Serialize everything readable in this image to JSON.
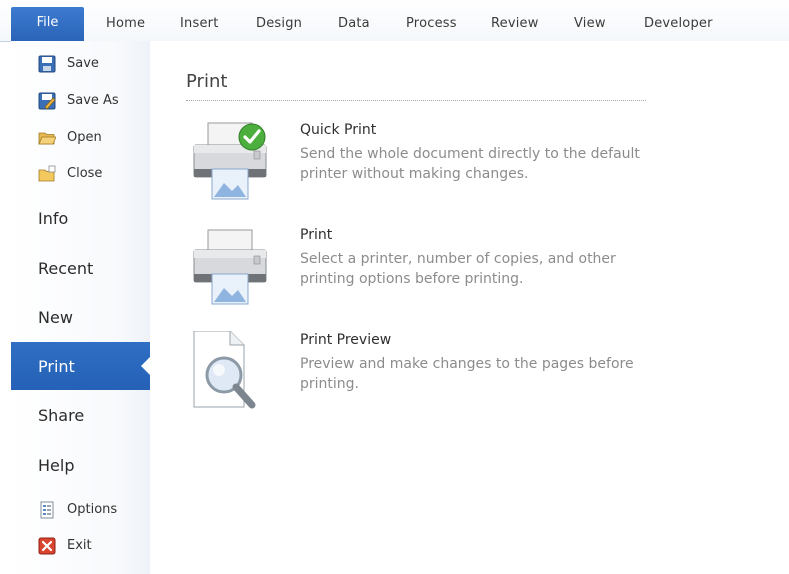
{
  "ribbon": {
    "tabs": [
      {
        "label": "File"
      },
      {
        "label": "Home"
      },
      {
        "label": "Insert"
      },
      {
        "label": "Design"
      },
      {
        "label": "Data"
      },
      {
        "label": "Process"
      },
      {
        "label": "Review"
      },
      {
        "label": "View"
      },
      {
        "label": "Developer"
      }
    ],
    "active_tab": "File"
  },
  "sidebar": {
    "commands": [
      {
        "label": "Save",
        "icon": "save-icon"
      },
      {
        "label": "Save As",
        "icon": "save-as-icon"
      },
      {
        "label": "Open",
        "icon": "open-folder-icon"
      },
      {
        "label": "Close",
        "icon": "close-folder-icon"
      }
    ],
    "tabs": [
      {
        "label": "Info"
      },
      {
        "label": "Recent"
      },
      {
        "label": "New"
      },
      {
        "label": "Print"
      },
      {
        "label": "Share"
      },
      {
        "label": "Help"
      }
    ],
    "active_tab": "Print",
    "footer": [
      {
        "label": "Options",
        "icon": "options-icon"
      },
      {
        "label": "Exit",
        "icon": "exit-icon"
      }
    ]
  },
  "main": {
    "title": "Print",
    "options": [
      {
        "title": "Quick Print",
        "description": "Send the whole document directly to the default printer without making changes.",
        "icon": "quick-print-icon"
      },
      {
        "title": "Print",
        "description": "Select a printer, number of copies, and other printing options before printing.",
        "icon": "printer-icon"
      },
      {
        "title": "Print Preview",
        "description": "Preview and make changes to the pages before printing.",
        "icon": "print-preview-icon"
      }
    ]
  },
  "colors": {
    "accent": "#2a64b8",
    "sidebar_bg": "#f7f9fc",
    "desc_text": "#8c8c8c"
  }
}
